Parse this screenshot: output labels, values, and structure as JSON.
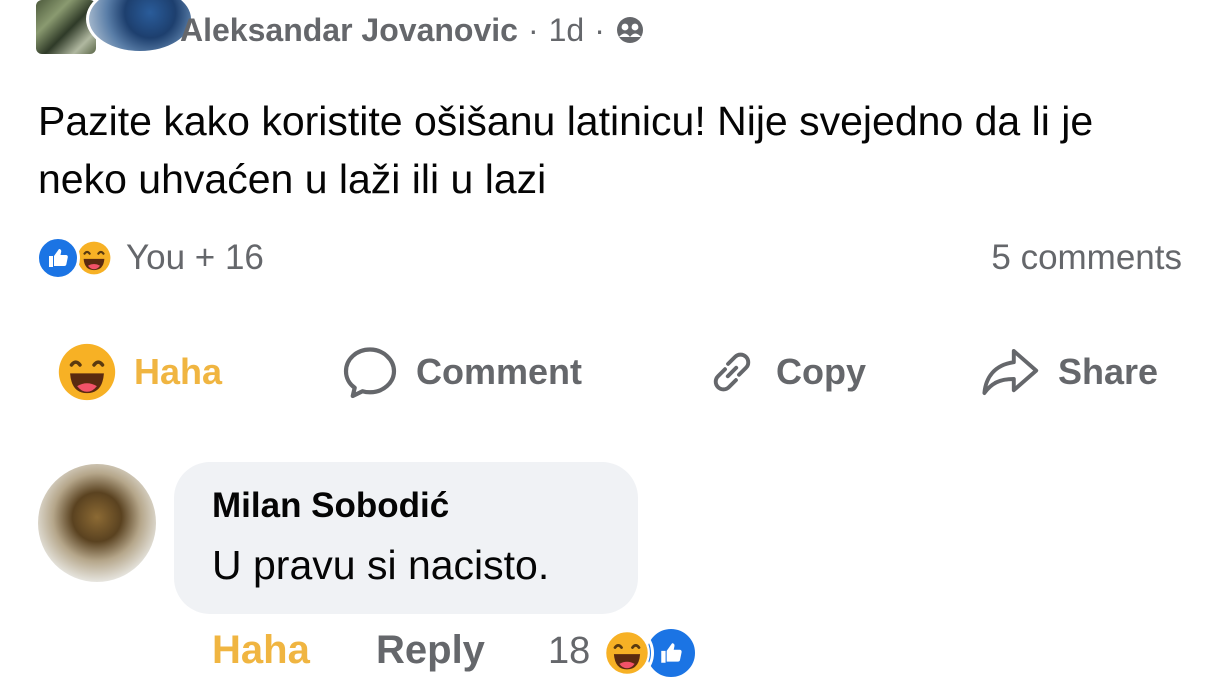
{
  "post": {
    "author": "Aleksandar Jovanovic",
    "time": "1d",
    "separator": "·",
    "audience_icon": "friends-icon",
    "text": "Pazite kako koristite ošišanu latinicu! Nije svejedno da li je neko uhvaćen u laži ili u lazi",
    "reactions_summary": "You + 16",
    "comments_count": "5 comments"
  },
  "actions": {
    "haha": "Haha",
    "comment": "Comment",
    "copy": "Copy",
    "share": "Share"
  },
  "comment": {
    "author": "Milan Sobodić",
    "text": "U pravu si nacisto.",
    "haha_label": "Haha",
    "reply_label": "Reply",
    "reaction_count": "18"
  },
  "colors": {
    "haha_active": "#f0b541",
    "like_blue": "#1b74e4",
    "secondary_text": "#65676b",
    "bubble_bg": "#f0f2f5"
  }
}
